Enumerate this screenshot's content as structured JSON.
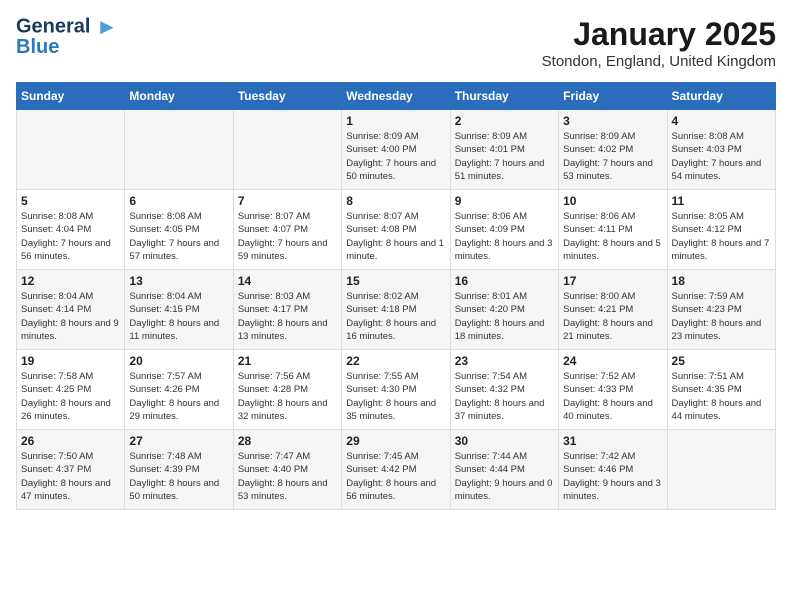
{
  "logo": {
    "line1": "General",
    "line2": "Blue"
  },
  "title": "January 2025",
  "subtitle": "Stondon, England, United Kingdom",
  "days_of_week": [
    "Sunday",
    "Monday",
    "Tuesday",
    "Wednesday",
    "Thursday",
    "Friday",
    "Saturday"
  ],
  "weeks": [
    [
      {
        "day": "",
        "sunrise": "",
        "sunset": "",
        "daylight": ""
      },
      {
        "day": "",
        "sunrise": "",
        "sunset": "",
        "daylight": ""
      },
      {
        "day": "",
        "sunrise": "",
        "sunset": "",
        "daylight": ""
      },
      {
        "day": "1",
        "sunrise": "Sunrise: 8:09 AM",
        "sunset": "Sunset: 4:00 PM",
        "daylight": "Daylight: 7 hours and 50 minutes."
      },
      {
        "day": "2",
        "sunrise": "Sunrise: 8:09 AM",
        "sunset": "Sunset: 4:01 PM",
        "daylight": "Daylight: 7 hours and 51 minutes."
      },
      {
        "day": "3",
        "sunrise": "Sunrise: 8:09 AM",
        "sunset": "Sunset: 4:02 PM",
        "daylight": "Daylight: 7 hours and 53 minutes."
      },
      {
        "day": "4",
        "sunrise": "Sunrise: 8:08 AM",
        "sunset": "Sunset: 4:03 PM",
        "daylight": "Daylight: 7 hours and 54 minutes."
      }
    ],
    [
      {
        "day": "5",
        "sunrise": "Sunrise: 8:08 AM",
        "sunset": "Sunset: 4:04 PM",
        "daylight": "Daylight: 7 hours and 56 minutes."
      },
      {
        "day": "6",
        "sunrise": "Sunrise: 8:08 AM",
        "sunset": "Sunset: 4:05 PM",
        "daylight": "Daylight: 7 hours and 57 minutes."
      },
      {
        "day": "7",
        "sunrise": "Sunrise: 8:07 AM",
        "sunset": "Sunset: 4:07 PM",
        "daylight": "Daylight: 7 hours and 59 minutes."
      },
      {
        "day": "8",
        "sunrise": "Sunrise: 8:07 AM",
        "sunset": "Sunset: 4:08 PM",
        "daylight": "Daylight: 8 hours and 1 minute."
      },
      {
        "day": "9",
        "sunrise": "Sunrise: 8:06 AM",
        "sunset": "Sunset: 4:09 PM",
        "daylight": "Daylight: 8 hours and 3 minutes."
      },
      {
        "day": "10",
        "sunrise": "Sunrise: 8:06 AM",
        "sunset": "Sunset: 4:11 PM",
        "daylight": "Daylight: 8 hours and 5 minutes."
      },
      {
        "day": "11",
        "sunrise": "Sunrise: 8:05 AM",
        "sunset": "Sunset: 4:12 PM",
        "daylight": "Daylight: 8 hours and 7 minutes."
      }
    ],
    [
      {
        "day": "12",
        "sunrise": "Sunrise: 8:04 AM",
        "sunset": "Sunset: 4:14 PM",
        "daylight": "Daylight: 8 hours and 9 minutes."
      },
      {
        "day": "13",
        "sunrise": "Sunrise: 8:04 AM",
        "sunset": "Sunset: 4:15 PM",
        "daylight": "Daylight: 8 hours and 11 minutes."
      },
      {
        "day": "14",
        "sunrise": "Sunrise: 8:03 AM",
        "sunset": "Sunset: 4:17 PM",
        "daylight": "Daylight: 8 hours and 13 minutes."
      },
      {
        "day": "15",
        "sunrise": "Sunrise: 8:02 AM",
        "sunset": "Sunset: 4:18 PM",
        "daylight": "Daylight: 8 hours and 16 minutes."
      },
      {
        "day": "16",
        "sunrise": "Sunrise: 8:01 AM",
        "sunset": "Sunset: 4:20 PM",
        "daylight": "Daylight: 8 hours and 18 minutes."
      },
      {
        "day": "17",
        "sunrise": "Sunrise: 8:00 AM",
        "sunset": "Sunset: 4:21 PM",
        "daylight": "Daylight: 8 hours and 21 minutes."
      },
      {
        "day": "18",
        "sunrise": "Sunrise: 7:59 AM",
        "sunset": "Sunset: 4:23 PM",
        "daylight": "Daylight: 8 hours and 23 minutes."
      }
    ],
    [
      {
        "day": "19",
        "sunrise": "Sunrise: 7:58 AM",
        "sunset": "Sunset: 4:25 PM",
        "daylight": "Daylight: 8 hours and 26 minutes."
      },
      {
        "day": "20",
        "sunrise": "Sunrise: 7:57 AM",
        "sunset": "Sunset: 4:26 PM",
        "daylight": "Daylight: 8 hours and 29 minutes."
      },
      {
        "day": "21",
        "sunrise": "Sunrise: 7:56 AM",
        "sunset": "Sunset: 4:28 PM",
        "daylight": "Daylight: 8 hours and 32 minutes."
      },
      {
        "day": "22",
        "sunrise": "Sunrise: 7:55 AM",
        "sunset": "Sunset: 4:30 PM",
        "daylight": "Daylight: 8 hours and 35 minutes."
      },
      {
        "day": "23",
        "sunrise": "Sunrise: 7:54 AM",
        "sunset": "Sunset: 4:32 PM",
        "daylight": "Daylight: 8 hours and 37 minutes."
      },
      {
        "day": "24",
        "sunrise": "Sunrise: 7:52 AM",
        "sunset": "Sunset: 4:33 PM",
        "daylight": "Daylight: 8 hours and 40 minutes."
      },
      {
        "day": "25",
        "sunrise": "Sunrise: 7:51 AM",
        "sunset": "Sunset: 4:35 PM",
        "daylight": "Daylight: 8 hours and 44 minutes."
      }
    ],
    [
      {
        "day": "26",
        "sunrise": "Sunrise: 7:50 AM",
        "sunset": "Sunset: 4:37 PM",
        "daylight": "Daylight: 8 hours and 47 minutes."
      },
      {
        "day": "27",
        "sunrise": "Sunrise: 7:48 AM",
        "sunset": "Sunset: 4:39 PM",
        "daylight": "Daylight: 8 hours and 50 minutes."
      },
      {
        "day": "28",
        "sunrise": "Sunrise: 7:47 AM",
        "sunset": "Sunset: 4:40 PM",
        "daylight": "Daylight: 8 hours and 53 minutes."
      },
      {
        "day": "29",
        "sunrise": "Sunrise: 7:45 AM",
        "sunset": "Sunset: 4:42 PM",
        "daylight": "Daylight: 8 hours and 56 minutes."
      },
      {
        "day": "30",
        "sunrise": "Sunrise: 7:44 AM",
        "sunset": "Sunset: 4:44 PM",
        "daylight": "Daylight: 9 hours and 0 minutes."
      },
      {
        "day": "31",
        "sunrise": "Sunrise: 7:42 AM",
        "sunset": "Sunset: 4:46 PM",
        "daylight": "Daylight: 9 hours and 3 minutes."
      },
      {
        "day": "",
        "sunrise": "",
        "sunset": "",
        "daylight": ""
      }
    ]
  ]
}
